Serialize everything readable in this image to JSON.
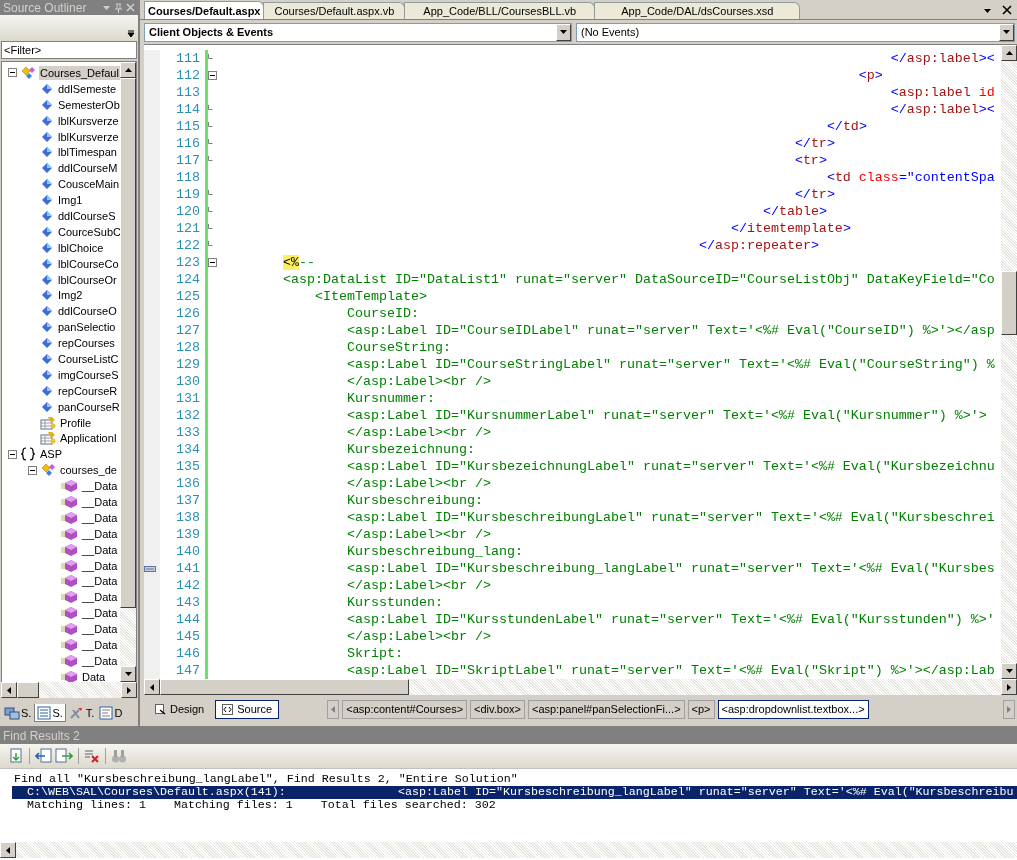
{
  "outliner": {
    "title": "Source Outliner",
    "filter": "<Filter>",
    "tree": [
      {
        "label": "Courses_Defaul",
        "kind": "class",
        "expanded": true,
        "selected": true,
        "children": [
          {
            "label": "ddlSemeste",
            "kind": "control",
            "selected": false
          },
          {
            "label": "SemesterOb",
            "kind": "control",
            "selected": false
          },
          {
            "label": "lblKursverze",
            "kind": "control",
            "selected": false
          },
          {
            "label": "lblKursverze",
            "kind": "control",
            "selected": false
          },
          {
            "label": "lblTimespan",
            "kind": "control",
            "selected": false
          },
          {
            "label": "ddlCourseM",
            "kind": "control",
            "selected": false
          },
          {
            "label": "CousceMain",
            "kind": "control",
            "selected": false
          },
          {
            "label": "Img1",
            "kind": "control",
            "selected": false
          },
          {
            "label": "ddlCourseS",
            "kind": "control",
            "selected": false
          },
          {
            "label": "CourceSubC",
            "kind": "control",
            "selected": false
          },
          {
            "label": "lblChoice",
            "kind": "control",
            "selected": false
          },
          {
            "label": "lblCourseCo",
            "kind": "control",
            "selected": false
          },
          {
            "label": "lblCourseOr",
            "kind": "control",
            "selected": false
          },
          {
            "label": "Img2",
            "kind": "control",
            "selected": false
          },
          {
            "label": "ddlCourseO",
            "kind": "control",
            "selected": false
          },
          {
            "label": "panSelectio",
            "kind": "control",
            "selected": false
          },
          {
            "label": "repCourses",
            "kind": "control",
            "selected": false
          },
          {
            "label": "CourseListC",
            "kind": "control",
            "selected": false
          },
          {
            "label": "imgCourseS",
            "kind": "control",
            "selected": false
          },
          {
            "label": "repCourseR",
            "kind": "control",
            "selected": false
          },
          {
            "label": "panCourseR",
            "kind": "control",
            "selected": false
          },
          {
            "label": "Profile",
            "kind": "profile",
            "selected": false
          },
          {
            "label": "ApplicationI",
            "kind": "profile",
            "selected": false
          }
        ]
      },
      {
        "label": "ASP",
        "kind": "namespace",
        "expanded": true,
        "selected": false,
        "children": [
          {
            "label": "courses_de",
            "kind": "class",
            "expanded": true,
            "selected": false,
            "children": [
              {
                "label": "__Data",
                "kind": "method",
                "selected": false
              },
              {
                "label": "__Data",
                "kind": "method",
                "selected": false
              },
              {
                "label": "__Data",
                "kind": "method",
                "selected": false
              },
              {
                "label": "__Data",
                "kind": "method",
                "selected": false
              },
              {
                "label": "__Data",
                "kind": "method",
                "selected": false
              },
              {
                "label": "__Data",
                "kind": "method",
                "selected": false
              },
              {
                "label": "__Data",
                "kind": "method",
                "selected": false
              },
              {
                "label": "__Data",
                "kind": "method",
                "selected": false
              },
              {
                "label": "__Data",
                "kind": "method",
                "selected": false
              },
              {
                "label": "__Data",
                "kind": "method",
                "selected": false
              },
              {
                "label": "__Data",
                "kind": "method",
                "selected": false
              },
              {
                "label": "__Data",
                "kind": "method",
                "selected": false
              },
              {
                "label": "Data",
                "kind": "method",
                "selected": false
              }
            ]
          }
        ]
      }
    ],
    "tabs": [
      {
        "label": "S.",
        "kind": "servers",
        "selected": false
      },
      {
        "label": "S.",
        "kind": "outline",
        "selected": true
      },
      {
        "label": "T.",
        "kind": "tools",
        "selected": false
      },
      {
        "label": "D",
        "kind": "document",
        "selected": false
      }
    ]
  },
  "editor": {
    "tabs": [
      {
        "label": "Courses/Default.aspx",
        "selected": true
      },
      {
        "label": "Courses/Default.aspx.vb",
        "selected": false
      },
      {
        "label": "App_Code/BLL/CoursesBLL.vb",
        "selected": false
      },
      {
        "label": "App_Code/DAL/dsCourses.xsd",
        "selected": false
      }
    ],
    "object_dropdown": "Client Objects & Events",
    "event_dropdown": "(No Events)",
    "lines": [
      {
        "n": "111",
        "collapsible": false,
        "block_end": true,
        "bookmark": false,
        "segs": [
          {
            "text": "\t\t\t\t\t\t\t\t\t\t\t\t\t\t\t\t\t\t\t\t\t</",
            "kind": "bracket"
          },
          {
            "text": "asp:label",
            "kind": "tag"
          },
          {
            "text": "><",
            "kind": "bracket"
          }
        ]
      },
      {
        "n": "112",
        "collapsible": true,
        "block_end": false,
        "bookmark": false,
        "segs": [
          {
            "text": "\t\t\t\t\t\t\t\t\t\t\t\t\t\t\t\t\t\t\t\t<",
            "kind": "bracket"
          },
          {
            "text": "p",
            "kind": "tag"
          },
          {
            "text": ">",
            "kind": "bracket"
          }
        ]
      },
      {
        "n": "113",
        "collapsible": false,
        "block_end": false,
        "bookmark": false,
        "segs": [
          {
            "text": "\t\t\t\t\t\t\t\t\t\t\t\t\t\t\t\t\t\t\t\t\t<",
            "kind": "bracket"
          },
          {
            "text": "asp:label",
            "kind": "tag"
          },
          {
            "text": " id",
            "kind": "attribute"
          }
        ]
      },
      {
        "n": "114",
        "collapsible": false,
        "block_end": true,
        "bookmark": false,
        "segs": [
          {
            "text": "\t\t\t\t\t\t\t\t\t\t\t\t\t\t\t\t\t\t\t\t\t</",
            "kind": "bracket"
          },
          {
            "text": "asp:label",
            "kind": "tag"
          },
          {
            "text": "><",
            "kind": "bracket"
          }
        ]
      },
      {
        "n": "115",
        "collapsible": false,
        "block_end": true,
        "bookmark": false,
        "segs": [
          {
            "text": "\t\t\t\t\t\t\t\t\t\t\t\t\t\t\t\t\t\t\t</",
            "kind": "bracket"
          },
          {
            "text": "td",
            "kind": "tag"
          },
          {
            "text": ">",
            "kind": "bracket"
          }
        ]
      },
      {
        "n": "116",
        "collapsible": false,
        "block_end": true,
        "bookmark": false,
        "segs": [
          {
            "text": "\t\t\t\t\t\t\t\t\t\t\t\t\t\t\t\t\t\t</",
            "kind": "bracket"
          },
          {
            "text": "tr",
            "kind": "tag"
          },
          {
            "text": ">",
            "kind": "bracket"
          }
        ]
      },
      {
        "n": "117",
        "collapsible": false,
        "block_end": true,
        "bookmark": false,
        "segs": [
          {
            "text": "\t\t\t\t\t\t\t\t\t\t\t\t\t\t\t\t\t\t<",
            "kind": "bracket"
          },
          {
            "text": "tr",
            "kind": "tag"
          },
          {
            "text": ">",
            "kind": "bracket"
          }
        ]
      },
      {
        "n": "118",
        "collapsible": false,
        "block_end": false,
        "bookmark": false,
        "segs": [
          {
            "text": "\t\t\t\t\t\t\t\t\t\t\t\t\t\t\t\t\t\t\t<",
            "kind": "bracket"
          },
          {
            "text": "td",
            "kind": "tag"
          },
          {
            "text": " class",
            "kind": "attribute"
          },
          {
            "text": "=\"contentSpa",
            "kind": "value"
          }
        ]
      },
      {
        "n": "119",
        "collapsible": false,
        "block_end": true,
        "bookmark": false,
        "segs": [
          {
            "text": "\t\t\t\t\t\t\t\t\t\t\t\t\t\t\t\t\t\t</",
            "kind": "bracket"
          },
          {
            "text": "tr",
            "kind": "tag"
          },
          {
            "text": ">",
            "kind": "bracket"
          }
        ]
      },
      {
        "n": "120",
        "collapsible": false,
        "block_end": true,
        "bookmark": false,
        "segs": [
          {
            "text": "\t\t\t\t\t\t\t\t\t\t\t\t\t\t\t\t\t</",
            "kind": "bracket"
          },
          {
            "text": "table",
            "kind": "tag"
          },
          {
            "text": ">",
            "kind": "bracket"
          }
        ]
      },
      {
        "n": "121",
        "collapsible": false,
        "block_end": true,
        "bookmark": false,
        "segs": [
          {
            "text": "\t\t\t\t\t\t\t\t\t\t\t\t\t\t\t\t</",
            "kind": "bracket"
          },
          {
            "text": "itemtemplate",
            "kind": "tag"
          },
          {
            "text": ">",
            "kind": "bracket"
          }
        ]
      },
      {
        "n": "122",
        "collapsible": false,
        "block_end": true,
        "bookmark": false,
        "segs": [
          {
            "text": "\t\t\t\t\t\t\t\t\t\t\t\t\t\t\t</",
            "kind": "bracket"
          },
          {
            "text": "asp:repeater",
            "kind": "tag"
          },
          {
            "text": ">",
            "kind": "bracket"
          }
        ]
      },
      {
        "n": "123",
        "collapsible": true,
        "block_end": false,
        "bookmark": false,
        "segs": [
          {
            "text": "\t\t<%",
            "kind": "delimiter"
          },
          {
            "text": "--",
            "kind": "comment"
          }
        ]
      },
      {
        "n": "124",
        "collapsible": false,
        "block_end": false,
        "bookmark": false,
        "segs": [
          {
            "text": "\t\t<asp:DataList ID=\"DataList1\" runat=\"server\" DataSourceID=\"CourseListObj\" DataKeyField=\"Co",
            "kind": "comment"
          }
        ]
      },
      {
        "n": "125",
        "collapsible": false,
        "block_end": false,
        "bookmark": false,
        "segs": [
          {
            "text": "\t\t\t<ItemTemplate>",
            "kind": "comment"
          }
        ]
      },
      {
        "n": "126",
        "collapsible": false,
        "block_end": false,
        "bookmark": false,
        "segs": [
          {
            "text": "\t\t\t\tCourseID:",
            "kind": "comment"
          }
        ]
      },
      {
        "n": "127",
        "collapsible": false,
        "block_end": false,
        "bookmark": false,
        "segs": [
          {
            "text": "\t\t\t\t<asp:Label ID=\"CourseIDLabel\" runat=\"server\" Text='<%# Eval(\"CourseID\") %>'></asp",
            "kind": "comment"
          }
        ]
      },
      {
        "n": "128",
        "collapsible": false,
        "block_end": false,
        "bookmark": false,
        "segs": [
          {
            "text": "\t\t\t\tCourseString:",
            "kind": "comment"
          }
        ]
      },
      {
        "n": "129",
        "collapsible": false,
        "block_end": false,
        "bookmark": false,
        "segs": [
          {
            "text": "\t\t\t\t<asp:Label ID=\"CourseStringLabel\" runat=\"server\" Text='<%# Eval(\"CourseString\") %",
            "kind": "comment"
          }
        ]
      },
      {
        "n": "130",
        "collapsible": false,
        "block_end": false,
        "bookmark": false,
        "segs": [
          {
            "text": "\t\t\t\t</asp:Label><br />",
            "kind": "comment"
          }
        ]
      },
      {
        "n": "131",
        "collapsible": false,
        "block_end": false,
        "bookmark": false,
        "segs": [
          {
            "text": "\t\t\t\tKursnummer:",
            "kind": "comment"
          }
        ]
      },
      {
        "n": "132",
        "collapsible": false,
        "block_end": false,
        "bookmark": false,
        "segs": [
          {
            "text": "\t\t\t\t<asp:Label ID=\"KursnummerLabel\" runat=\"server\" Text='<%# Eval(\"Kursnummer\") %>'>",
            "kind": "comment"
          }
        ]
      },
      {
        "n": "133",
        "collapsible": false,
        "block_end": false,
        "bookmark": false,
        "segs": [
          {
            "text": "\t\t\t\t</asp:Label><br />",
            "kind": "comment"
          }
        ]
      },
      {
        "n": "134",
        "collapsible": false,
        "block_end": false,
        "bookmark": false,
        "segs": [
          {
            "text": "\t\t\t\tKursbezeichnung:",
            "kind": "comment"
          }
        ]
      },
      {
        "n": "135",
        "collapsible": false,
        "block_end": false,
        "bookmark": false,
        "segs": [
          {
            "text": "\t\t\t\t<asp:Label ID=\"KursbezeichnungLabel\" runat=\"server\" Text='<%# Eval(\"Kursbezeichnu",
            "kind": "comment"
          }
        ]
      },
      {
        "n": "136",
        "collapsible": false,
        "block_end": false,
        "bookmark": false,
        "segs": [
          {
            "text": "\t\t\t\t</asp:Label><br />",
            "kind": "comment"
          }
        ]
      },
      {
        "n": "137",
        "collapsible": false,
        "block_end": false,
        "bookmark": false,
        "segs": [
          {
            "text": "\t\t\t\tKursbeschreibung:",
            "kind": "comment"
          }
        ]
      },
      {
        "n": "138",
        "collapsible": false,
        "block_end": false,
        "bookmark": false,
        "segs": [
          {
            "text": "\t\t\t\t<asp:Label ID=\"KursbeschreibungLabel\" runat=\"server\" Text='<%# Eval(\"Kursbeschrei",
            "kind": "comment"
          }
        ]
      },
      {
        "n": "139",
        "collapsible": false,
        "block_end": false,
        "bookmark": false,
        "segs": [
          {
            "text": "\t\t\t\t</asp:Label><br />",
            "kind": "comment"
          }
        ]
      },
      {
        "n": "140",
        "collapsible": false,
        "block_end": false,
        "bookmark": false,
        "segs": [
          {
            "text": "\t\t\t\tKursbeschreibung_lang:",
            "kind": "comment"
          }
        ]
      },
      {
        "n": "141",
        "collapsible": false,
        "block_end": false,
        "bookmark": true,
        "segs": [
          {
            "text": "\t\t\t\t<asp:Label ID=\"Kursbeschreibung_langLabel\" runat=\"server\" Text='<%# Eval(\"Kursbes",
            "kind": "comment"
          }
        ]
      },
      {
        "n": "142",
        "collapsible": false,
        "block_end": false,
        "bookmark": false,
        "segs": [
          {
            "text": "\t\t\t\t</asp:Label><br />",
            "kind": "comment"
          }
        ]
      },
      {
        "n": "143",
        "collapsible": false,
        "block_end": false,
        "bookmark": false,
        "segs": [
          {
            "text": "\t\t\t\tKursstunden:",
            "kind": "comment"
          }
        ]
      },
      {
        "n": "144",
        "collapsible": false,
        "block_end": false,
        "bookmark": false,
        "segs": [
          {
            "text": "\t\t\t\t<asp:Label ID=\"KursstundenLabel\" runat=\"server\" Text='<%# Eval(\"Kursstunden\") %>'",
            "kind": "comment"
          }
        ]
      },
      {
        "n": "145",
        "collapsible": false,
        "block_end": false,
        "bookmark": false,
        "segs": [
          {
            "text": "\t\t\t\t</asp:Label><br />",
            "kind": "comment"
          }
        ]
      },
      {
        "n": "146",
        "collapsible": false,
        "block_end": false,
        "bookmark": false,
        "segs": [
          {
            "text": "\t\t\t\tSkript:",
            "kind": "comment"
          }
        ]
      },
      {
        "n": "147",
        "collapsible": false,
        "block_end": false,
        "bookmark": false,
        "segs": [
          {
            "text": "\t\t\t\t<asp:Label ID=\"SkriptLabel\" runat=\"server\" Text='<%# Eval(\"Skript\") %>'></asp:Lab",
            "kind": "comment"
          }
        ]
      }
    ],
    "views": [
      {
        "label": "Design",
        "kind": "design",
        "selected": false
      },
      {
        "label": "Source",
        "kind": "source",
        "selected": true
      }
    ],
    "breadcrumbs": [
      {
        "label": "<asp:content#Courses>",
        "selected": false
      },
      {
        "label": "<div.box>",
        "selected": false
      },
      {
        "label": "<asp:panel#panSelectionFi...>",
        "selected": false
      },
      {
        "label": "<p>",
        "selected": false
      },
      {
        "label": "<asp:dropdownlist.textbox...>",
        "selected": true
      }
    ]
  },
  "find_results": {
    "title": "Find Results 2",
    "lines": [
      {
        "text": "Find all \"Kursbeschreibung_langLabel\", Find Results 2, \"Entire Solution\"",
        "kind": "header",
        "selected": false
      },
      {
        "text": "C:\\WEB\\SAL\\Courses\\Default.aspx(141):",
        "match": "<asp:Label ID=\"Kursbeschreibung_langLabel\" runat=\"server\" Text='<%# Eval(\"Kursbeschreibu",
        "kind": "result",
        "selected": true
      },
      {
        "text": "Matching lines: 1    Matching files: 1    Total files searched: 302",
        "kind": "summary",
        "selected": false
      }
    ]
  }
}
